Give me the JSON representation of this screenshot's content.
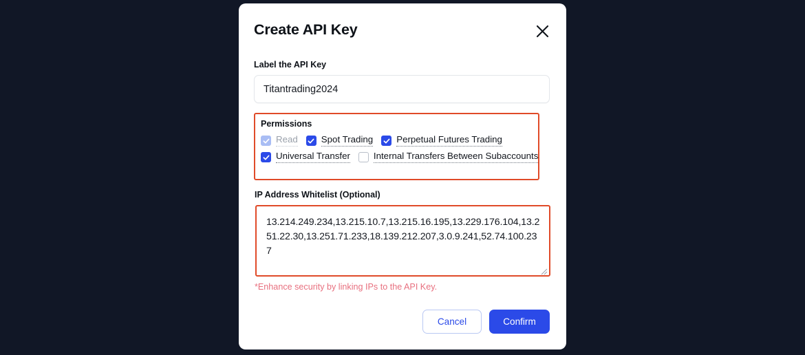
{
  "modal": {
    "title": "Create API Key",
    "close_icon": "close-x-icon"
  },
  "label_field": {
    "label": "Label the API Key",
    "value": "Titantrading2024",
    "placeholder": ""
  },
  "permissions": {
    "title": "Permissions",
    "highlight_color": "#e04a28",
    "items": [
      {
        "label": "Read",
        "checked": true,
        "disabled": true
      },
      {
        "label": "Spot Trading",
        "checked": true,
        "disabled": false
      },
      {
        "label": "Perpetual Futures Trading",
        "checked": true,
        "disabled": false
      },
      {
        "label": "Universal Transfer",
        "checked": true,
        "disabled": false
      },
      {
        "label": "Internal Transfers Between Subaccounts",
        "checked": false,
        "disabled": false
      }
    ]
  },
  "ip_whitelist": {
    "label": "IP Address Whitelist (Optional)",
    "value": "13.214.249.234,13.215.10.7,13.215.16.195,13.229.176.104,13.251.22.30,13.251.71.233,18.139.212.207,3.0.9.241,52.74.100.237",
    "placeholder": "",
    "helper_text": "*Enhance security by linking IPs to the API Key.",
    "helper_color": "#e8707f",
    "highlight_color": "#e04a28"
  },
  "footer": {
    "cancel_label": "Cancel",
    "confirm_label": "Confirm",
    "accent_color": "#2b4ae8"
  }
}
